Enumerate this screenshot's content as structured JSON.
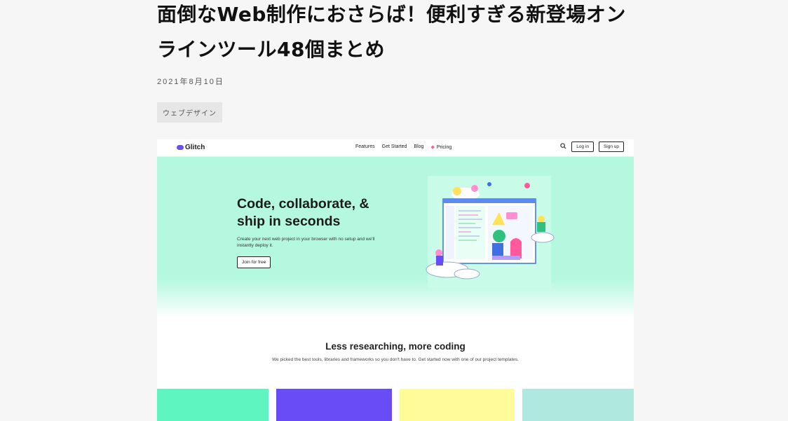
{
  "article": {
    "title": "面倒なWeb制作におさらば！便利すぎる新登場オンラインツール48個まとめ",
    "date": "2021年8月10日",
    "tag": "ウェブデザイン"
  },
  "glitch": {
    "logo": "Glitch",
    "nav_links": [
      "Features",
      "Get Started",
      "Blog",
      "Pricing"
    ],
    "search_icon": "search-icon",
    "login": "Log in",
    "signup": "Sign up",
    "hero_title": "Code, collaborate, & ship in seconds",
    "hero_sub": "Create your next web project in your browser with no setup and we'll instantly deploy it.",
    "join_button": "Join for free",
    "section_title": "Less researching, more coding",
    "section_sub": "We picked the best tools, libraries and frameworks so you don't have to. Get started now with one of our project templates.",
    "card_colors": [
      "#5ef5c0",
      "#6a4cf6",
      "#fffb98",
      "#aee8de"
    ]
  },
  "colors": {
    "page_bg": "#f6f6f6",
    "hero_bg": "#b5f8e0",
    "tag_bg": "#e6e6e6"
  }
}
